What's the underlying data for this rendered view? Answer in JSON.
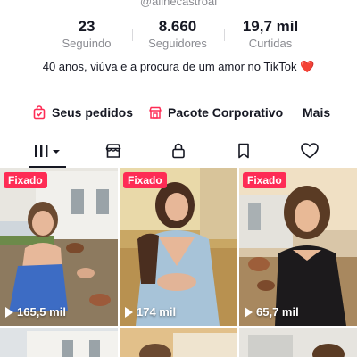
{
  "profile": {
    "handle": "@alinecastroal",
    "stats": [
      {
        "value": "23",
        "label": "Seguindo"
      },
      {
        "value": "8.660",
        "label": "Seguidores"
      },
      {
        "value": "19,7 mil",
        "label": "Curtidas"
      }
    ],
    "bio_text": "40 anos, viúva e a procura de um amor no TikTok",
    "bio_emoji": "❤️"
  },
  "links": {
    "orders": "Seus pedidos",
    "corporate": "Pacote Corporativo",
    "more": "Mais"
  },
  "tabs": [
    {
      "icon": "grid-icon",
      "active": true
    },
    {
      "icon": "shop-icon",
      "active": false
    },
    {
      "icon": "lock-icon",
      "active": false
    },
    {
      "icon": "bookmark-icon",
      "active": false
    },
    {
      "icon": "heart-icon",
      "active": false
    }
  ],
  "videos": [
    {
      "pinned_label": "Fixado",
      "views": "165,5 mil"
    },
    {
      "pinned_label": "Fixado",
      "views": "174 mil"
    },
    {
      "pinned_label": "Fixado",
      "views": "65,7 mil"
    }
  ],
  "colors": {
    "accent": "#fe2c55",
    "text": "#161823",
    "muted": "#8a8b91"
  }
}
